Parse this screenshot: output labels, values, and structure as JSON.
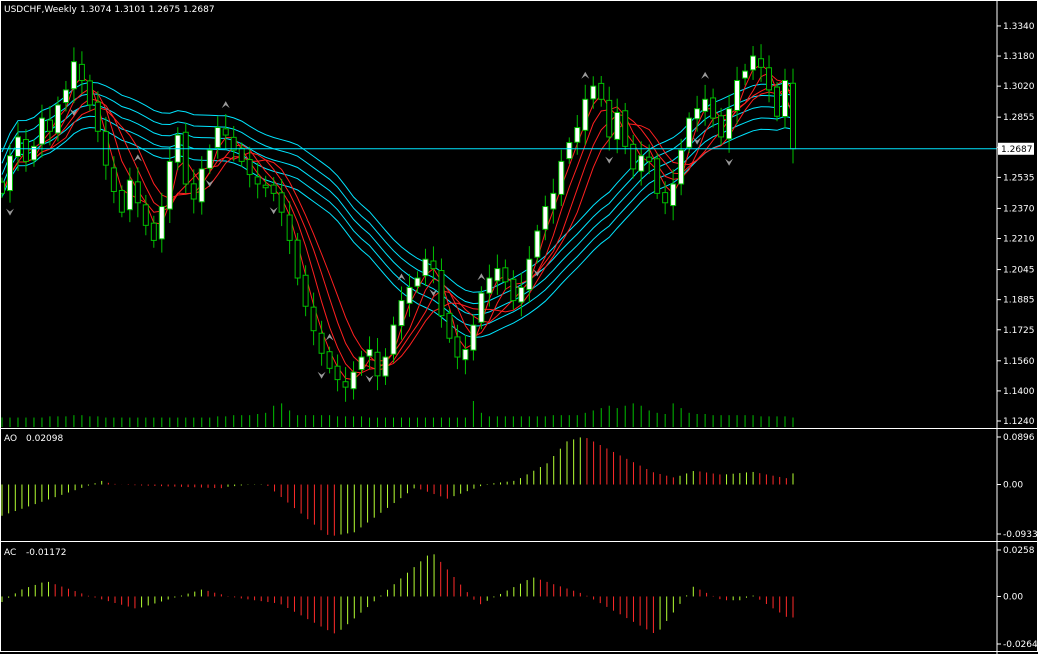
{
  "header": {
    "symbol": "USDCHF,Weekly",
    "ohlc": "1.3074 1.3101 1.2675 1.2687"
  },
  "ao_panel": {
    "label": "AO",
    "value": "0.02098"
  },
  "ac_panel": {
    "label": "AC",
    "value": "-0.01172"
  },
  "colors": {
    "background": "#000000",
    "axis": "#ffffff",
    "candle_up": "#ffffff",
    "candle_down": "#000000",
    "wick": "#00c000",
    "volume": "#00c000",
    "band_cyan": "#00e5ff",
    "band_red": "#ff2020",
    "fractal": "#9a9a9a",
    "osc_up": "#b4ff32",
    "osc_down": "#ff2a2a"
  },
  "chart_data": [
    {
      "type": "candlestick",
      "title": "USDCHF,Weekly",
      "ylim": [
        1.124,
        1.343
      ],
      "y_ticks": [
        "1.3340",
        "1.3180",
        "1.3020",
        "1.2855",
        "1.2695",
        "1.2535",
        "1.2370",
        "1.2210",
        "1.2045",
        "1.1885",
        "1.1725",
        "1.1560",
        "1.1400",
        "1.1240"
      ],
      "current_price": "1.2687",
      "close": [
        1.245,
        1.265,
        1.275,
        1.262,
        1.27,
        1.285,
        1.278,
        1.292,
        1.3,
        1.315,
        1.305,
        1.292,
        1.278,
        1.26,
        1.246,
        1.235,
        1.252,
        1.24,
        1.228,
        1.22,
        1.238,
        1.262,
        1.276,
        1.25,
        1.242,
        1.258,
        1.268,
        1.28,
        1.276,
        1.268,
        1.262,
        1.255,
        1.25,
        1.248,
        1.245,
        1.235,
        1.22,
        1.2,
        1.185,
        1.172,
        1.16,
        1.152,
        1.146,
        1.142,
        1.15,
        1.158,
        1.162,
        1.148,
        1.158,
        1.175,
        1.188,
        1.195,
        1.2,
        1.21,
        1.205,
        1.18,
        1.168,
        1.158,
        1.162,
        1.175,
        1.192,
        1.2,
        1.205,
        1.198,
        1.188,
        1.195,
        1.21,
        1.225,
        1.238,
        1.245,
        1.262,
        1.272,
        1.28,
        1.295,
        1.302,
        1.295,
        1.275,
        1.288,
        1.27,
        1.258,
        1.265,
        1.262,
        1.245,
        1.24,
        1.25,
        1.268,
        1.285,
        1.29,
        1.295,
        1.285,
        1.275,
        1.29,
        1.305,
        1.31,
        1.318,
        1.312,
        1.3,
        1.286,
        1.305,
        1.2687
      ],
      "volume": [
        8,
        8,
        8,
        8,
        8,
        8,
        9,
        9,
        9,
        10,
        10,
        9,
        9,
        8,
        8,
        8,
        8,
        8,
        8,
        8,
        8,
        8,
        8,
        8,
        8,
        8,
        8,
        9,
        9,
        10,
        10,
        10,
        11,
        12,
        18,
        20,
        14,
        10,
        10,
        10,
        10,
        10,
        9,
        9,
        9,
        9,
        8,
        8,
        8,
        8,
        8,
        8,
        8,
        8,
        8,
        8,
        8,
        8,
        8,
        22,
        12,
        9,
        9,
        9,
        9,
        9,
        9,
        9,
        9,
        10,
        10,
        10,
        10,
        12,
        14,
        16,
        18,
        16,
        18,
        20,
        18,
        14,
        12,
        11,
        20,
        16,
        12,
        11,
        11,
        10,
        10,
        10,
        10,
        10,
        10,
        9,
        9,
        9,
        9,
        8
      ],
      "fractals_up_index": [
        17,
        28,
        41,
        50,
        60,
        73,
        88,
        100,
        111,
        117,
        141
      ],
      "fractals_down_index": [
        1,
        9,
        26,
        34,
        40,
        46,
        54,
        67,
        76,
        87,
        91,
        115,
        125,
        132,
        139
      ]
    },
    {
      "type": "bar",
      "title": "AO",
      "current": "0.02098",
      "ylim": [
        -0.0933,
        0.0896
      ],
      "y_ticks": [
        "0.0896",
        "0.00",
        "-0.0933"
      ],
      "values": [
        -0.0588,
        -0.0544,
        -0.05,
        -0.0457,
        -0.0413,
        -0.0369,
        -0.0326,
        -0.0282,
        -0.0238,
        -0.0195,
        -0.0151,
        -0.0107,
        -0.0063,
        -0.002,
        0.0024,
        0.0068,
        0.0032,
        0.0011,
        -0.0002,
        -0.0008,
        -0.0013,
        -0.0018,
        -0.0022,
        -0.0026,
        -0.0031,
        -0.0035,
        -0.0039,
        -0.0043,
        -0.0048,
        -0.0052,
        -0.0056,
        -0.0061,
        -0.0065,
        -0.0069,
        -0.0042,
        -0.003,
        -0.0018,
        -0.0006,
        0.0006,
        0.0006,
        -0.0027,
        -0.0131,
        -0.0236,
        -0.034,
        -0.0444,
        -0.0548,
        -0.0653,
        -0.0757,
        -0.0861,
        -0.0949,
        -0.0964,
        -0.0943,
        -0.0922,
        -0.0901,
        -0.0809,
        -0.0717,
        -0.0625,
        -0.0533,
        -0.0441,
        -0.0349,
        -0.0257,
        -0.0165,
        -0.0073,
        -0.0093,
        -0.0136,
        -0.018,
        -0.0223,
        -0.0267,
        -0.022,
        -0.0173,
        -0.0125,
        -0.0078,
        -0.0031,
        0.0009,
        0.0024,
        0.0039,
        0.0054,
        0.0069,
        0.0121,
        0.0191,
        0.026,
        0.033,
        0.04,
        0.0538,
        0.0676,
        0.0814,
        0.0851,
        0.0888,
        0.0876,
        0.0811,
        0.0745,
        0.068,
        0.0614,
        0.0548,
        0.0484,
        0.0421,
        0.0357,
        0.0293,
        0.0231,
        0.0199,
        0.0167,
        0.0135,
        0.0165,
        0.0209,
        0.0254,
        0.0246,
        0.0227,
        0.0208,
        0.019,
        0.0192,
        0.0204,
        0.0216,
        0.0228,
        0.0237,
        0.0214,
        0.019,
        0.0167,
        0.0143,
        0.012,
        0.021
      ]
    },
    {
      "type": "bar",
      "title": "AC",
      "current": "-0.01172",
      "ylim": [
        -0.0264,
        0.0258
      ],
      "y_ticks": [
        "0.0258",
        "0.00",
        "-0.0264"
      ],
      "values": [
        -0.0031,
        -0.0007,
        0.0017,
        0.0039,
        0.0052,
        0.0064,
        0.0077,
        0.0081,
        0.0068,
        0.0055,
        0.0043,
        0.003,
        0.0017,
        0.0004,
        -0.0006,
        -0.0016,
        -0.0026,
        -0.0036,
        -0.0046,
        -0.0056,
        -0.0066,
        -0.0061,
        -0.005,
        -0.0039,
        -0.0028,
        -0.0017,
        -0.0006,
        0.0005,
        0.0016,
        0.0027,
        0.0038,
        0.0031,
        0.0021,
        0.0012,
        0.0002,
        -0.0005,
        -0.0011,
        -0.0016,
        -0.0021,
        -0.0026,
        -0.0031,
        -0.0036,
        -0.0044,
        -0.0064,
        -0.0085,
        -0.0105,
        -0.0126,
        -0.0146,
        -0.0167,
        -0.0187,
        -0.0205,
        -0.0185,
        -0.0154,
        -0.0122,
        -0.009,
        -0.0059,
        -0.0027,
        0.0005,
        0.0037,
        0.0068,
        0.01,
        0.0132,
        0.0163,
        0.0195,
        0.0227,
        0.0234,
        0.0192,
        0.015,
        0.0108,
        0.0066,
        0.0024,
        -0.0018,
        -0.0043,
        -0.0024,
        -0.0005,
        0.0014,
        0.0033,
        0.0052,
        0.0071,
        0.0091,
        0.0105,
        0.0093,
        0.0081,
        0.0068,
        0.0056,
        0.0044,
        0.0032,
        0.002,
        0.0004,
        -0.0017,
        -0.0037,
        -0.0058,
        -0.0079,
        -0.0099,
        -0.012,
        -0.0141,
        -0.0162,
        -0.0183,
        -0.0203,
        -0.0184,
        -0.0136,
        -0.0089,
        -0.0041,
        0.0006,
        0.0054,
        0.0038,
        0.002,
        0.0003,
        -0.0015,
        -0.0021,
        -0.0021,
        -0.0021,
        -0.0007,
        0.0005,
        -0.0018,
        -0.0042,
        -0.0066,
        -0.0089,
        -0.0113,
        -0.0117
      ]
    }
  ]
}
